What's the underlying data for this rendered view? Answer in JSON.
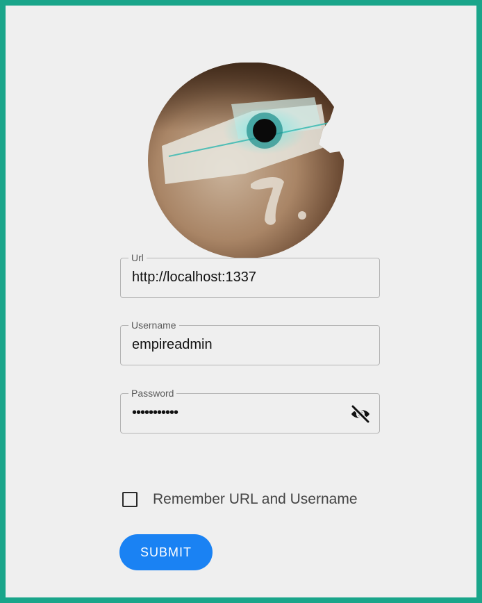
{
  "form": {
    "url": {
      "label": "Url",
      "value": "http://localhost:1337"
    },
    "username": {
      "label": "Username",
      "value": "empireadmin"
    },
    "password": {
      "label": "Password",
      "masked_value": "•••••••••••",
      "toggle_icon": "eye-slash-icon"
    },
    "remember": {
      "label": "Remember URL and Username",
      "checked": false
    },
    "submit_label": "SUBMIT"
  },
  "colors": {
    "frame_border": "#1aa58a",
    "background": "#efefef",
    "submit_bg": "#1a82f3"
  },
  "icons": {
    "logo": "empire-logo-icon",
    "password_toggle": "eye-slash-icon"
  }
}
